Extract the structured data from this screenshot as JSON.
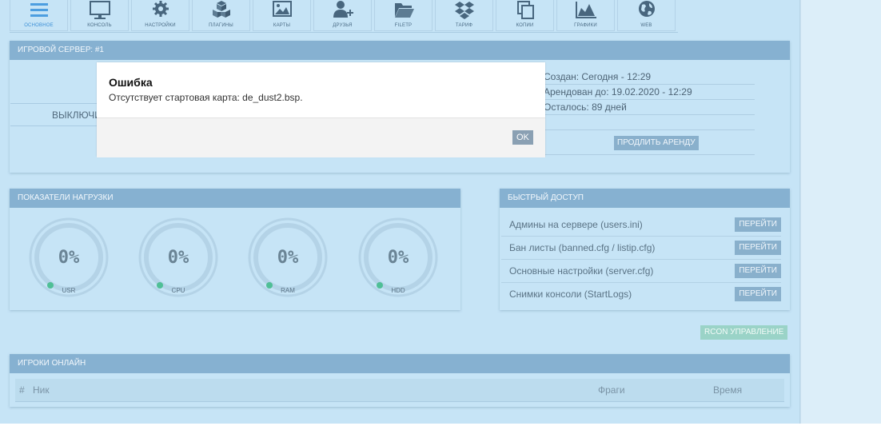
{
  "toolbar": {
    "items": [
      {
        "label": "ОСНОВНОЕ",
        "icon": "menu-icon"
      },
      {
        "label": "КОНСОЛЬ",
        "icon": "monitor-icon"
      },
      {
        "label": "НАСТРОЙКИ",
        "icon": "gear-icon"
      },
      {
        "label": "ПЛАГИНЫ",
        "icon": "cubes-icon"
      },
      {
        "label": "КАРТЫ",
        "icon": "image-icon"
      },
      {
        "label": "ДРУЗЬЯ",
        "icon": "user-plus-icon"
      },
      {
        "label": "FILETP",
        "icon": "folder-icon"
      },
      {
        "label": "ТАРИФ",
        "icon": "dropbox-icon"
      },
      {
        "label": "КОПИИ",
        "icon": "copy-icon"
      },
      {
        "label": "ГРАФИКИ",
        "icon": "area-chart-icon"
      },
      {
        "label": "WEB",
        "icon": "globe-icon"
      }
    ]
  },
  "server": {
    "title": "ИГРОВОЙ СЕРВЕР: #1",
    "off_label": "ВЫКЛЮЧИТЬ",
    "created": "Создан: Сегодня - 12:29",
    "rented_until": "Арендован до: 19.02.2020 - 12:29",
    "remaining": "Осталось: 89 дней",
    "extend_label": "ПРОДЛИТЬ АРЕНДУ"
  },
  "load": {
    "title": "ПОКАЗАТЕЛИ НАГРУЗКИ",
    "gauges": [
      {
        "value": "0%",
        "label": "USR"
      },
      {
        "value": "0%",
        "label": "CPU"
      },
      {
        "value": "0%",
        "label": "RAM"
      },
      {
        "value": "0%",
        "label": "HDD"
      }
    ]
  },
  "quick": {
    "title": "БЫСТРЫЙ ДОСТУП",
    "go_label": "ПЕРЕЙТИ",
    "rows": [
      "Админы на сервере (users.ini)",
      "Бан листы (banned.cfg / listip.cfg)",
      "Основные настройки (server.cfg)",
      "Снимки консоли (StartLogs)"
    ]
  },
  "rcon_label": "RCON УПРАВЛЕНИЕ",
  "players": {
    "title": "ИГРОКИ ОНЛАЙН",
    "columns": [
      "#",
      "Ник",
      "Фраги",
      "Время"
    ]
  },
  "modal": {
    "title": "Ошибка",
    "message": "Отсутствует стартовая карта: de_dust2.bsp.",
    "ok_label": "OK"
  },
  "colors": {
    "background": "#c6e4f6",
    "panel_header": "#86b1d1",
    "accent_active": "#3b8fd6",
    "button": "#89b0cc",
    "rcon_button": "#9ad3c7"
  }
}
